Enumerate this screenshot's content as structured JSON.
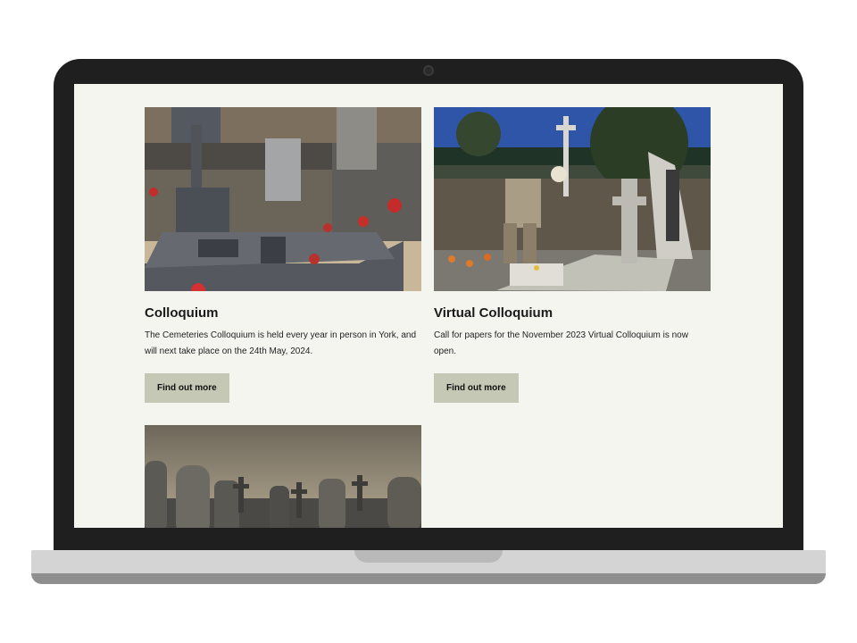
{
  "cards": [
    {
      "title": "Colloquium",
      "text": "The Cemeteries Colloquium is held every year in person in York, and will next take place on the 24th May, 2024.",
      "button_label": "Find out more",
      "image_icon": "cemetery-graves-photo"
    },
    {
      "title": "Virtual Colloquium",
      "text": "Call for papers for the November 2023 Virtual Colloquium is now open.",
      "button_label": "Find out more",
      "image_icon": "cemetery-visitor-photo"
    },
    {
      "image_icon": "gravestones-silhouette-photo"
    }
  ],
  "colors": {
    "screen_background": "#f5f5f0",
    "button_background": "#c5c8b4",
    "bezel": "#1f1f1f"
  }
}
